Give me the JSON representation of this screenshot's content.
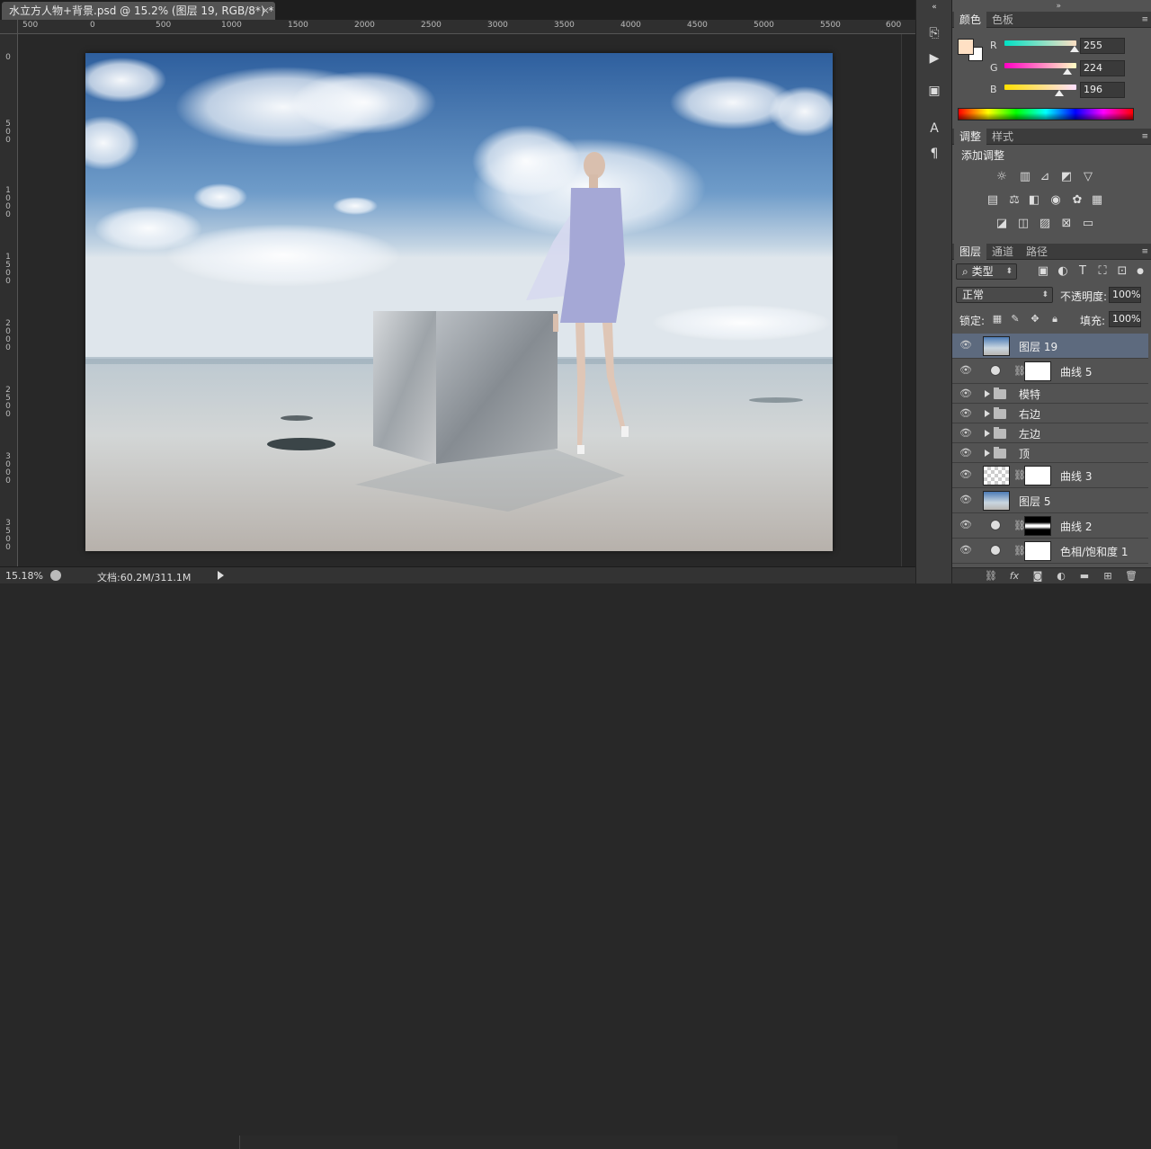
{
  "document": {
    "tab_title": "水立方人物+背景.psd @ 15.2% (图层 19, RGB/8*) *",
    "close_glyph": "×"
  },
  "rulers": {
    "horizontal": [
      "500",
      "0",
      "500",
      "1000",
      "1500",
      "2000",
      "2500",
      "3000",
      "3500",
      "4000",
      "4500",
      "5000",
      "5500",
      "600"
    ],
    "vertical": [
      "0",
      "500",
      "1000",
      "1500",
      "2000",
      "2500",
      "3000",
      "3500"
    ]
  },
  "status": {
    "zoom": "15.18%",
    "doc_size": "文档:60.2M/311.1M"
  },
  "colors": {
    "foreground": "#ffe0c4",
    "background": "#ffffff",
    "selected_layer": "#5d6a7e"
  },
  "color_panel": {
    "tabs": [
      "颜色",
      "色板"
    ],
    "channels": [
      {
        "label": "R",
        "value": "255",
        "level": 1.0
      },
      {
        "label": "G",
        "value": "224",
        "level": 0.878
      },
      {
        "label": "B",
        "value": "196",
        "level": 0.769
      }
    ]
  },
  "adjust_panel": {
    "tabs": [
      "调整",
      "样式"
    ],
    "title": "添加调整",
    "icons": [
      "brightness-icon",
      "levels-icon",
      "curves-icon",
      "exposure-icon",
      "vibrance-icon",
      "hue-saturation-icon",
      "color-balance-icon",
      "black-white-icon",
      "photo-filter-icon",
      "channel-mixer-icon",
      "color-lookup-icon",
      "invert-icon",
      "posterize-icon",
      "threshold-icon",
      "selective-color-icon",
      "gradient-map-icon"
    ]
  },
  "layers_panel": {
    "tabs": [
      "图层",
      "通道",
      "路径"
    ],
    "filter_label": "类型",
    "blend_mode": "正常",
    "opacity_label": "不透明度:",
    "opacity_value": "100%",
    "lock_label": "锁定:",
    "fill_label": "填充:",
    "fill_value": "100%",
    "layers": [
      {
        "name": "图层 19",
        "kind": "image",
        "selected": true
      },
      {
        "name": "曲线 5",
        "kind": "adjust"
      },
      {
        "name": "模特",
        "kind": "group"
      },
      {
        "name": "右边",
        "kind": "group"
      },
      {
        "name": "左边",
        "kind": "group"
      },
      {
        "name": "顶",
        "kind": "group"
      },
      {
        "name": "曲线 3",
        "kind": "adjust-transparent"
      },
      {
        "name": "图层 5",
        "kind": "image"
      },
      {
        "name": "曲线 2",
        "kind": "adjust-bar"
      },
      {
        "name": "色相/饱和度 1",
        "kind": "adjust"
      }
    ]
  }
}
